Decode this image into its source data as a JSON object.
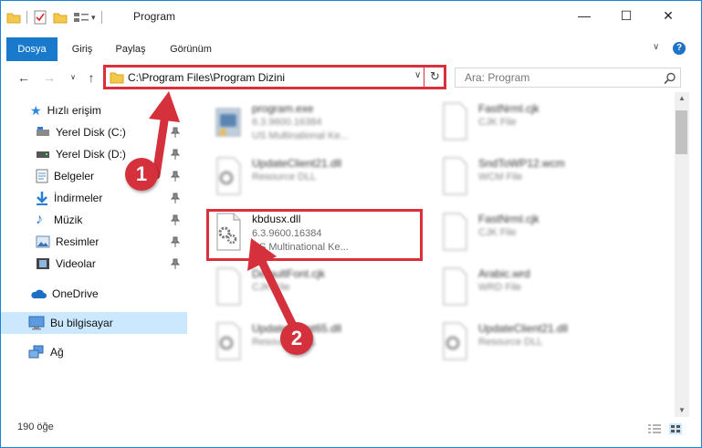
{
  "window": {
    "title": "Program",
    "controls": {
      "minimize": "—",
      "maximize": "☐",
      "close": "✕"
    }
  },
  "ribbon": {
    "tabs": [
      "Dosya",
      "Giriş",
      "Paylaş",
      "Görünüm"
    ],
    "help": "?"
  },
  "address": {
    "path": "C:\\Program Files\\Program Dizini",
    "search_placeholder": "Ara: Program"
  },
  "nav": {
    "quick_access": "Hızlı erişim",
    "pinned": [
      "Yerel Disk (C:)",
      "Yerel Disk (D:)",
      "Belgeler",
      "İndirmeler",
      "Müzik",
      "Resimler",
      "Videolar"
    ],
    "onedrive": "OneDrive",
    "this_pc": "Bu bilgisayar",
    "network": "Ağ"
  },
  "files": [
    {
      "name": "program.exe",
      "line2": "6.3.9600.16384",
      "line3": "US Multinational Ke..."
    },
    {
      "name": "FastNrml.cjk",
      "line2": "CJK File",
      "line3": ""
    },
    {
      "name": "UpdateClient21.dll",
      "line2": "Resource DLL",
      "line3": ""
    },
    {
      "name": "SndToWP12.wcm",
      "line2": "WCM File",
      "line3": ""
    },
    {
      "name": "kbdusx.dll",
      "line2": "6.3.9600.16384",
      "line3": "US Multinational Ke..."
    },
    {
      "name": "FastNrml.cjk",
      "line2": "CJK File",
      "line3": ""
    },
    {
      "name": "DefaultFont.cjk",
      "line2": "CJK File",
      "line3": ""
    },
    {
      "name": "Arabic.wrd",
      "line2": "WRD File",
      "line3": ""
    },
    {
      "name": "UpdateClient65.dll",
      "line2": "Resource DLL",
      "line3": ""
    },
    {
      "name": "UpdateClient21.dll",
      "line2": "Resource DLL",
      "line3": ""
    }
  ],
  "status": {
    "count": "190 öğe"
  },
  "callouts": [
    "1",
    "2"
  ],
  "colors": {
    "accent": "#1979ca",
    "highlight": "#d9303c",
    "selected_nav": "#cce8ff"
  }
}
